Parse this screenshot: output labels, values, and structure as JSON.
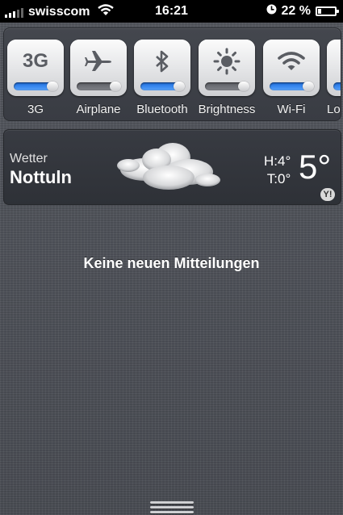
{
  "status_bar": {
    "carrier": "swisscom",
    "time": "16:21",
    "battery": "22 %",
    "battery_level": 0.22,
    "signal_bars": 3,
    "signal_bars_total": 5
  },
  "toggles": [
    {
      "label": "3G",
      "icon_text": "3G",
      "icon": "cellular-3g-icon",
      "on": true
    },
    {
      "label": "Airplane",
      "icon": "airplane-icon",
      "on": false
    },
    {
      "label": "Bluetooth",
      "icon": "bluetooth-icon",
      "on": true
    },
    {
      "label": "Brightness",
      "icon": "brightness-icon",
      "on": false
    },
    {
      "label": "Wi-Fi",
      "icon": "wifi-icon",
      "on": true
    },
    {
      "label": "Lo",
      "icon": "partial-icon",
      "on": true
    }
  ],
  "weather": {
    "label": "Wetter",
    "city": "Nottuln",
    "high": "H:4°",
    "low": "T:0°",
    "temp": "5°",
    "provider_badge": "Y!",
    "condition_icon": "cloud-icon"
  },
  "notifications": {
    "empty_message": "Keine neuen Mitteilungen"
  },
  "colors": {
    "toggle_on": "#2f80ea",
    "linen": "#4d5057"
  }
}
